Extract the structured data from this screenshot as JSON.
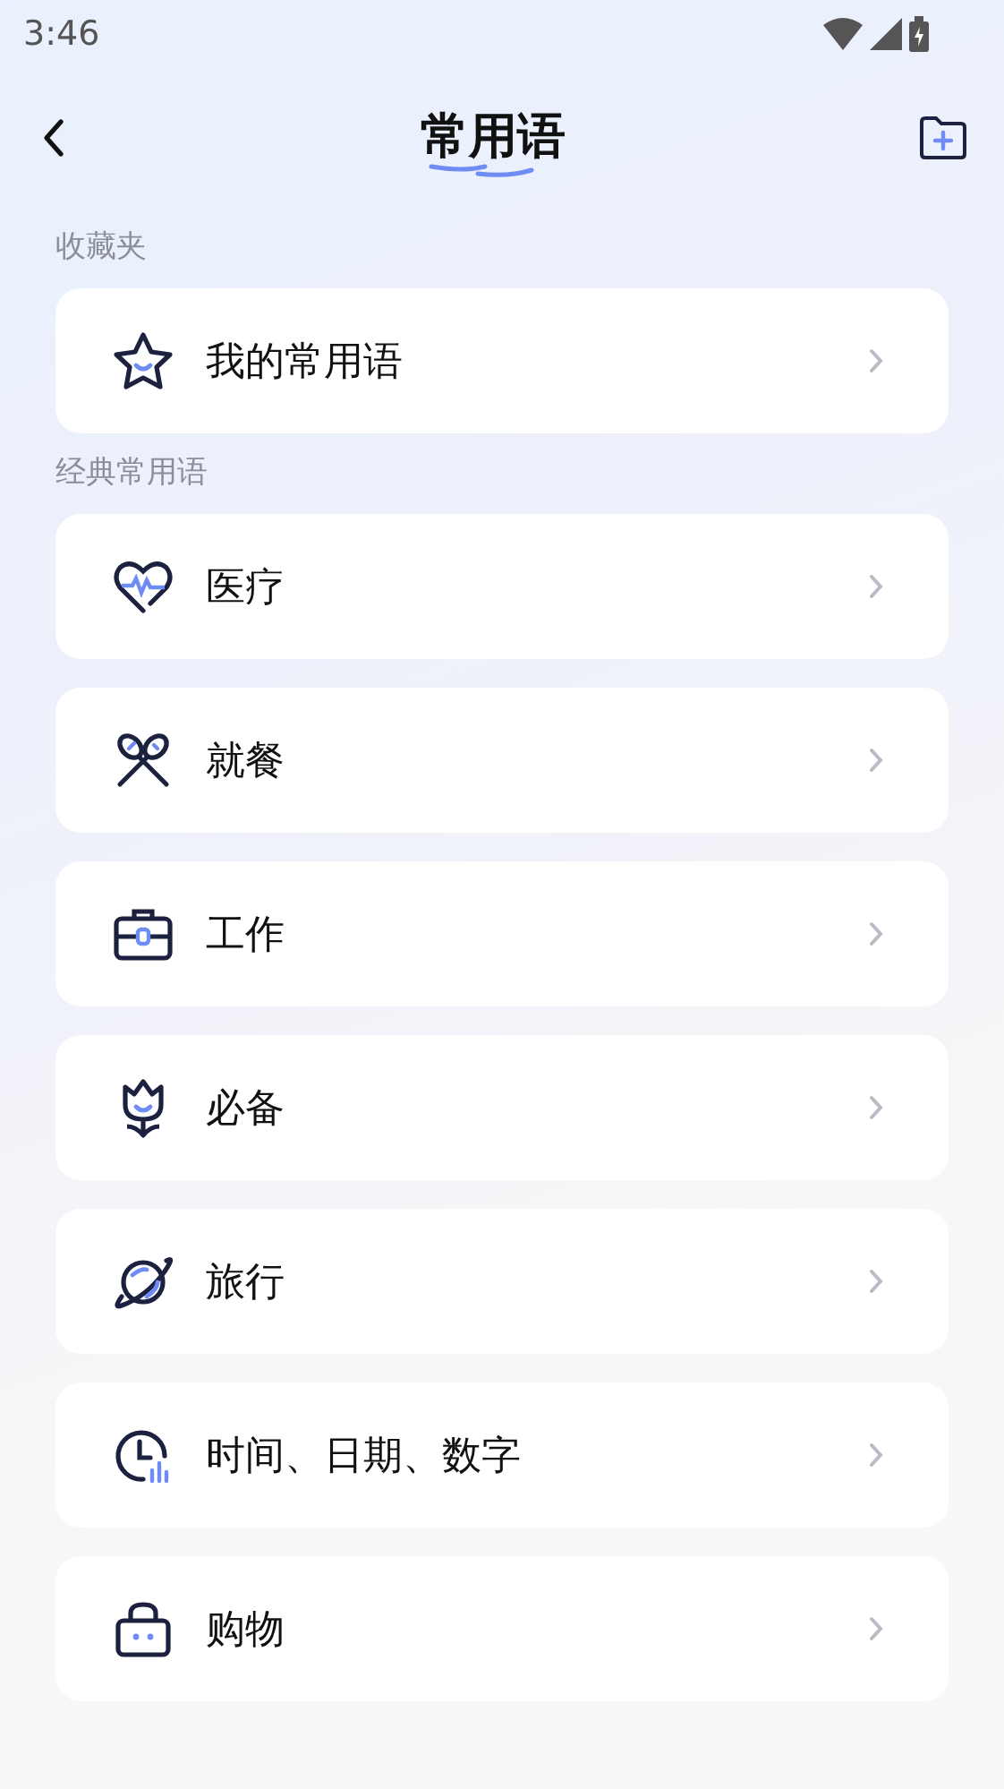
{
  "status_bar": {
    "time": "3:46"
  },
  "header": {
    "title": "常用语"
  },
  "sections": [
    {
      "title": "收藏夹",
      "items": [
        {
          "kind": "star",
          "label": "我的常用语"
        }
      ]
    },
    {
      "title": "经典常用语",
      "items": [
        {
          "kind": "heart",
          "label": "医疗"
        },
        {
          "kind": "utensils",
          "label": "就餐"
        },
        {
          "kind": "briefcase",
          "label": "工作"
        },
        {
          "kind": "tulip",
          "label": "必备"
        },
        {
          "kind": "planet",
          "label": "旅行"
        },
        {
          "kind": "clock",
          "label": "时间、日期、数字"
        },
        {
          "kind": "bag",
          "label": "购物"
        }
      ]
    }
  ]
}
